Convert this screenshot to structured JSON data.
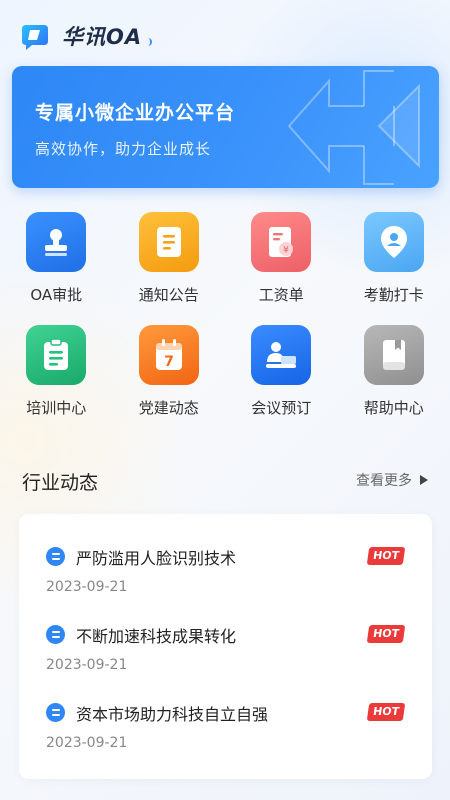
{
  "header": {
    "app_name": "华讯OA"
  },
  "banner": {
    "title": "专属小微企业办公平台",
    "subtitle": "高效协作，助力企业成长"
  },
  "apps": [
    {
      "label": "OA审批",
      "icon": "stamp-icon",
      "color": "#2a7df2"
    },
    {
      "label": "通知公告",
      "icon": "document-icon",
      "color": "#f7a51d"
    },
    {
      "label": "工资单",
      "icon": "payslip-icon",
      "color": "#f07478"
    },
    {
      "label": "考勤打卡",
      "icon": "location-pin-icon",
      "color": "#5fb6f8"
    },
    {
      "label": "培训中心",
      "icon": "clipboard-icon",
      "color": "#29bf7c"
    },
    {
      "label": "党建动态",
      "icon": "calendar-icon",
      "color": "#f7731e"
    },
    {
      "label": "会议预订",
      "icon": "meeting-icon",
      "color": "#1f7df6"
    },
    {
      "label": "帮助中心",
      "icon": "book-icon",
      "color": "#a3a3a3"
    }
  ],
  "news_section": {
    "title": "行业动态",
    "more_label": "查看更多",
    "items": [
      {
        "title": "严防滥用人脸识别技术",
        "date": "2023-09-21",
        "badge": "HOT"
      },
      {
        "title": "不断加速科技成果转化",
        "date": "2023-09-21",
        "badge": "HOT"
      },
      {
        "title": "资本市场助力科技自立自强",
        "date": "2023-09-21",
        "badge": "HOT"
      }
    ]
  }
}
